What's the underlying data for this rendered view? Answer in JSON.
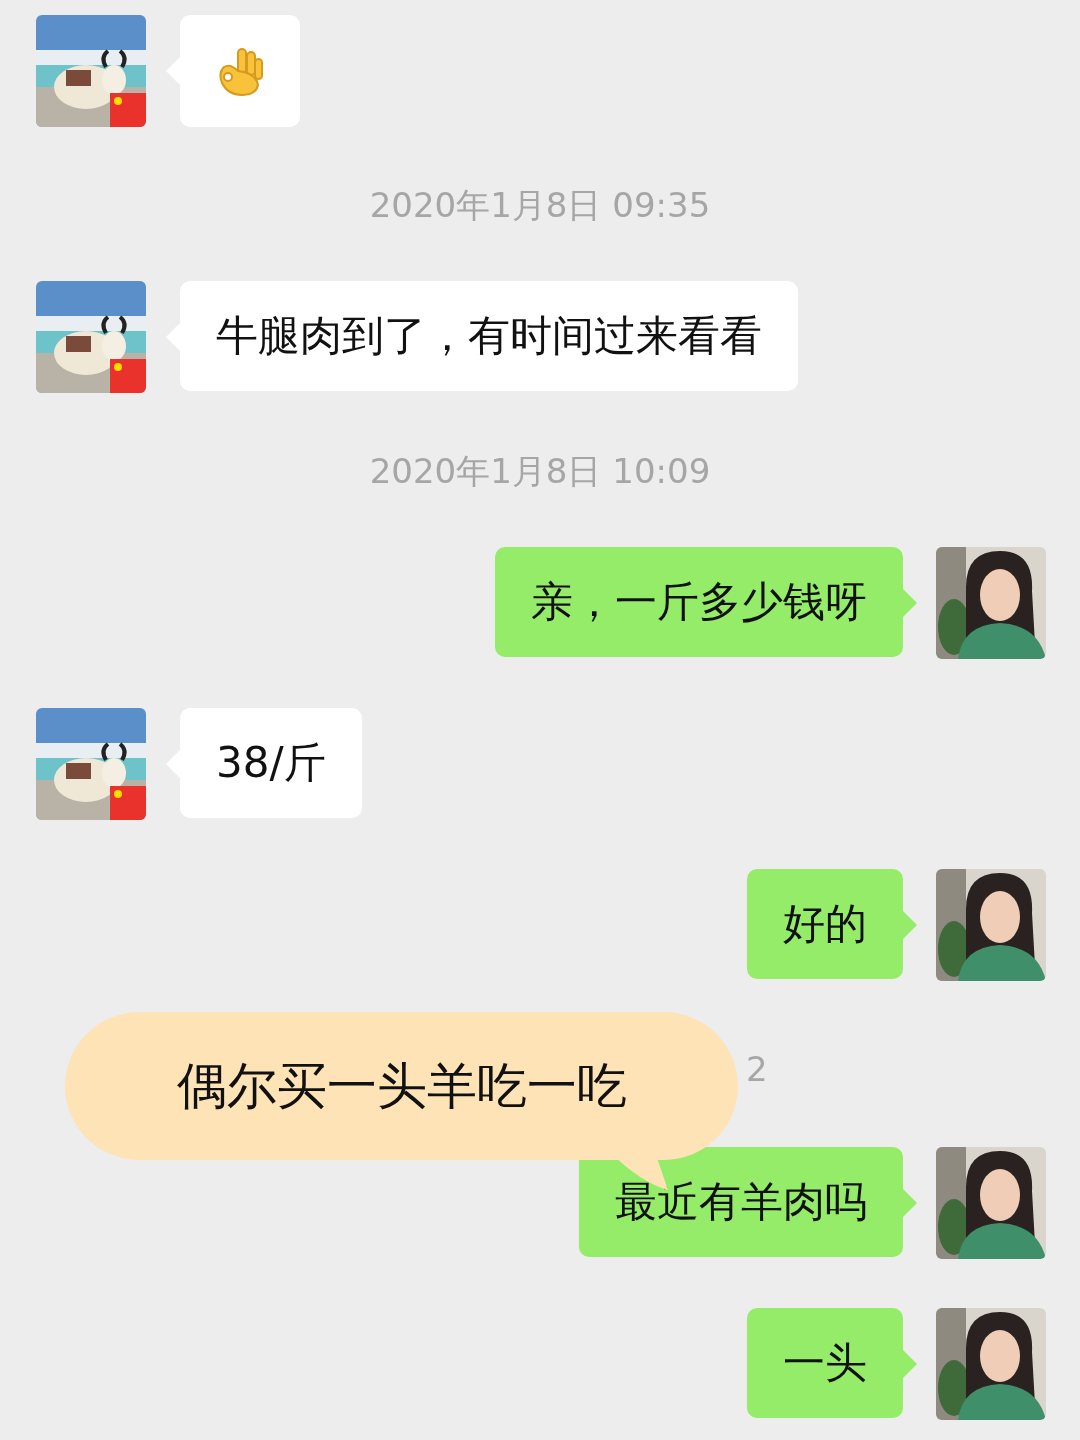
{
  "messages": [
    {
      "kind": "emoji",
      "mine": false
    },
    {
      "kind": "timestamp",
      "text": "2020年1月8日 09:35"
    },
    {
      "kind": "text",
      "mine": false,
      "text": "牛腿肉到了，有时间过来看看"
    },
    {
      "kind": "timestamp",
      "text": "2020年1月8日 10:09"
    },
    {
      "kind": "text",
      "mine": true,
      "text": "亲，一斤多少钱呀"
    },
    {
      "kind": "text",
      "mine": false,
      "text": "38/斤"
    },
    {
      "kind": "text",
      "mine": true,
      "text": "好的"
    },
    {
      "kind": "timestamp_fragment",
      "text": "2"
    },
    {
      "kind": "text",
      "mine": true,
      "text": "最近有羊肉吗"
    },
    {
      "kind": "text",
      "mine": true,
      "text": "一头"
    }
  ],
  "overlay_bubble": {
    "text": "偶尔买一头羊吃一吃"
  }
}
